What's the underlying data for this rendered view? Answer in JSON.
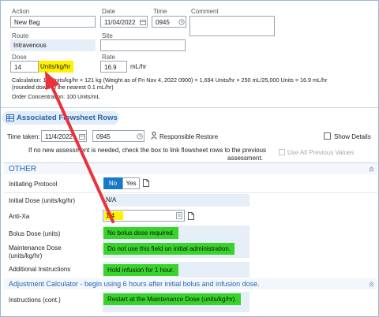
{
  "order": {
    "action": {
      "label": "Action",
      "value": "New Bag"
    },
    "date": {
      "label": "Date",
      "value": "11/04/2022"
    },
    "time": {
      "label": "Time",
      "value": "0945"
    },
    "comment": {
      "label": "Comment",
      "value": ""
    },
    "route": {
      "label": "Route",
      "value": "Intravenous"
    },
    "site": {
      "label": "Site",
      "value": ""
    },
    "dose": {
      "label": "Dose",
      "value": "14",
      "unit": "Units/kg/hr"
    },
    "rate": {
      "label": "Rate",
      "value": "16.9",
      "unit": "mL/hr"
    },
    "calculation_line1": "Calculation: 14 Units/kg/hr × 121 kg (Weight as of Fri Nov 4, 2022 0900) = 1,694 Units/hr × 250 mL/25,000 Units = 16.9 mL/hr",
    "calculation_line2": "(rounded down to the nearest 0.1 mL/hr)",
    "order_concentration": "Order Concentration: 100 Units/mL"
  },
  "flowsheet": {
    "title": "Associated Flowsheet Rows",
    "time_taken_label": "Time taken:",
    "time_taken_date": "11/4/2022",
    "time_taken_time": "0945",
    "responsible_label": "Responsible",
    "restore_label": "Restore",
    "show_details_label": "Show Details",
    "notice_line1": "If no new assessment is needed, check the box to link flowsheet rows to the previous",
    "notice_line2": "assessment.",
    "use_all_previous_label": "Use All Previous Values"
  },
  "other_section": {
    "title": "OTHER",
    "rows": {
      "initiating_protocol": {
        "label": "Initiating Protocol",
        "no": "No",
        "yes": "Yes"
      },
      "initial_dose": {
        "label": "Initial Dose (units/kg/hr)",
        "value": "N/A"
      },
      "anti_xa": {
        "label": "Anti-Xa",
        "value": "1.4"
      },
      "bolus_dose": {
        "label": "Bolus Dose (units)",
        "value": "No bolus dose required."
      },
      "maintenance_dose": {
        "label_line1": "Maintenance Dose",
        "label_line2": "(units/kg/hr)",
        "value": "Do not use this field on initial administration."
      },
      "additional_instructions": {
        "label": "Additional Instructions",
        "value": "Hold infusion for 1 hour."
      }
    }
  },
  "adjustment_section": {
    "title": "Adjustment Calculator - begin using 6 hours after initial bolus and infusion dose.",
    "instructions": {
      "label": "Instructions (cont.)",
      "value": "Restart at the Maintenance Dose (units/kg/hr)."
    }
  },
  "colors": {
    "highlight_yellow": "#fff200",
    "highlight_green": "#39d42b",
    "section_blue": "#1d67b3",
    "arrow_red": "#e8323c"
  }
}
